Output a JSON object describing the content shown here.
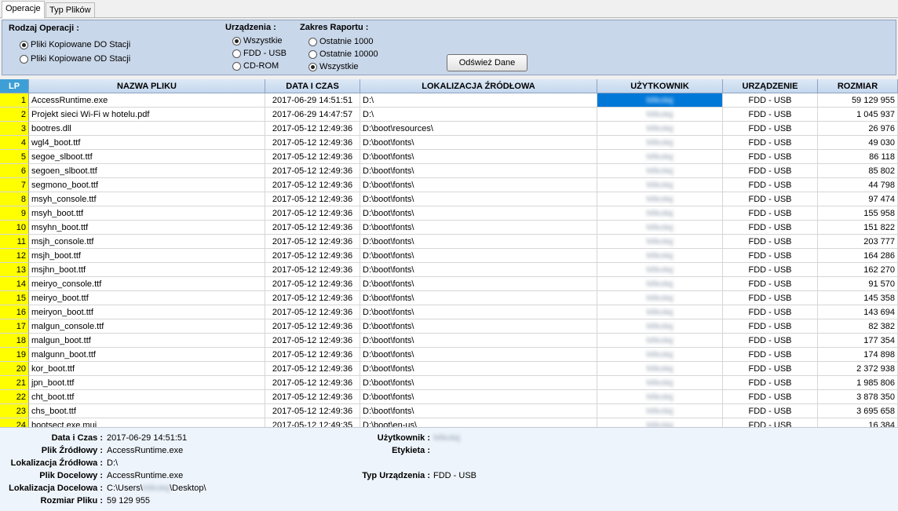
{
  "tabs": [
    "Operacje",
    "Typ Plików"
  ],
  "filters": {
    "operation": {
      "title": "Rodzaj Operacji :",
      "options": [
        "Pliki Kopiowane DO Stacji",
        "Pliki Kopiowane OD Stacji"
      ],
      "selected": 0
    },
    "devices": {
      "title": "Urządzenia :",
      "options": [
        "Wszystkie",
        "FDD - USB",
        "CD-ROM"
      ],
      "selected": 0
    },
    "range": {
      "title": "Zakres Raportu :",
      "options": [
        "Ostatnie 1000",
        "Ostatnie 10000",
        "Wszystkie"
      ],
      "selected": 2
    },
    "refresh_label": "Odśwież Dane"
  },
  "table": {
    "columns": [
      "LP",
      "NAZWA PLIKU",
      "DATA I CZAS",
      "LOKALIZACJA ŹRÓDŁOWA",
      "UŻYTKOWNIK",
      "URZĄDZENIE",
      "ROZMIAR"
    ],
    "user_redacted": "Mikołaj",
    "rows": [
      [
        "1",
        "AccessRuntime.exe",
        "2017-06-29 14:51:51",
        "D:\\",
        "FDD - USB",
        "59 129 955"
      ],
      [
        "2",
        "Projekt sieci Wi-Fi w hotelu.pdf",
        "2017-06-29 14:47:57",
        "D:\\",
        "FDD - USB",
        "1 045 937"
      ],
      [
        "3",
        "bootres.dll",
        "2017-05-12 12:49:36",
        "D:\\boot\\resources\\",
        "FDD - USB",
        "26 976"
      ],
      [
        "4",
        "wgl4_boot.ttf",
        "2017-05-12 12:49:36",
        "D:\\boot\\fonts\\",
        "FDD - USB",
        "49 030"
      ],
      [
        "5",
        "segoe_slboot.ttf",
        "2017-05-12 12:49:36",
        "D:\\boot\\fonts\\",
        "FDD - USB",
        "86 118"
      ],
      [
        "6",
        "segoen_slboot.ttf",
        "2017-05-12 12:49:36",
        "D:\\boot\\fonts\\",
        "FDD - USB",
        "85 802"
      ],
      [
        "7",
        "segmono_boot.ttf",
        "2017-05-12 12:49:36",
        "D:\\boot\\fonts\\",
        "FDD - USB",
        "44 798"
      ],
      [
        "8",
        "msyh_console.ttf",
        "2017-05-12 12:49:36",
        "D:\\boot\\fonts\\",
        "FDD - USB",
        "97 474"
      ],
      [
        "9",
        "msyh_boot.ttf",
        "2017-05-12 12:49:36",
        "D:\\boot\\fonts\\",
        "FDD - USB",
        "155 958"
      ],
      [
        "10",
        "msyhn_boot.ttf",
        "2017-05-12 12:49:36",
        "D:\\boot\\fonts\\",
        "FDD - USB",
        "151 822"
      ],
      [
        "11",
        "msjh_console.ttf",
        "2017-05-12 12:49:36",
        "D:\\boot\\fonts\\",
        "FDD - USB",
        "203 777"
      ],
      [
        "12",
        "msjh_boot.ttf",
        "2017-05-12 12:49:36",
        "D:\\boot\\fonts\\",
        "FDD - USB",
        "164 286"
      ],
      [
        "13",
        "msjhn_boot.ttf",
        "2017-05-12 12:49:36",
        "D:\\boot\\fonts\\",
        "FDD - USB",
        "162 270"
      ],
      [
        "14",
        "meiryo_console.ttf",
        "2017-05-12 12:49:36",
        "D:\\boot\\fonts\\",
        "FDD - USB",
        "91 570"
      ],
      [
        "15",
        "meiryo_boot.ttf",
        "2017-05-12 12:49:36",
        "D:\\boot\\fonts\\",
        "FDD - USB",
        "145 358"
      ],
      [
        "16",
        "meiryon_boot.ttf",
        "2017-05-12 12:49:36",
        "D:\\boot\\fonts\\",
        "FDD - USB",
        "143 694"
      ],
      [
        "17",
        "malgun_console.ttf",
        "2017-05-12 12:49:36",
        "D:\\boot\\fonts\\",
        "FDD - USB",
        "82 382"
      ],
      [
        "18",
        "malgun_boot.ttf",
        "2017-05-12 12:49:36",
        "D:\\boot\\fonts\\",
        "FDD - USB",
        "177 354"
      ],
      [
        "19",
        "malgunn_boot.ttf",
        "2017-05-12 12:49:36",
        "D:\\boot\\fonts\\",
        "FDD - USB",
        "174 898"
      ],
      [
        "20",
        "kor_boot.ttf",
        "2017-05-12 12:49:36",
        "D:\\boot\\fonts\\",
        "FDD - USB",
        "2 372 938"
      ],
      [
        "21",
        "jpn_boot.ttf",
        "2017-05-12 12:49:36",
        "D:\\boot\\fonts\\",
        "FDD - USB",
        "1 985 806"
      ],
      [
        "22",
        "cht_boot.ttf",
        "2017-05-12 12:49:36",
        "D:\\boot\\fonts\\",
        "FDD - USB",
        "3 878 350"
      ],
      [
        "23",
        "chs_boot.ttf",
        "2017-05-12 12:49:36",
        "D:\\boot\\fonts\\",
        "FDD - USB",
        "3 695 658"
      ],
      [
        "24",
        "bootsect.exe.mui",
        "2017-05-12 12:49:35",
        "D:\\boot\\en-us\\",
        "FDD - USB",
        "16 384"
      ]
    ]
  },
  "details": {
    "datetime_label": "Data i Czas :",
    "datetime_value": "2017-06-29 14:51:51",
    "source_file_label": "Plik Źródłowy :",
    "source_file_value": "AccessRuntime.exe",
    "source_loc_label": "Lokalizacja Źródłowa :",
    "source_loc_value": "D:\\",
    "target_file_label": "Plik Docelowy :",
    "target_file_value": "AccessRuntime.exe",
    "target_loc_label": "Lokalizacja Docelowa :",
    "target_loc_prefix": "C:\\Users\\",
    "target_loc_suffix": "\\Desktop\\",
    "size_label": "Rozmiar Pliku :",
    "size_value": "59 129 955",
    "user_label": "Użytkownik :",
    "user_value": "Mikołaj",
    "tag_label": "Etykieta :",
    "device_type_label": "Typ Urządzenia :",
    "device_type_value": "FDD - USB"
  }
}
